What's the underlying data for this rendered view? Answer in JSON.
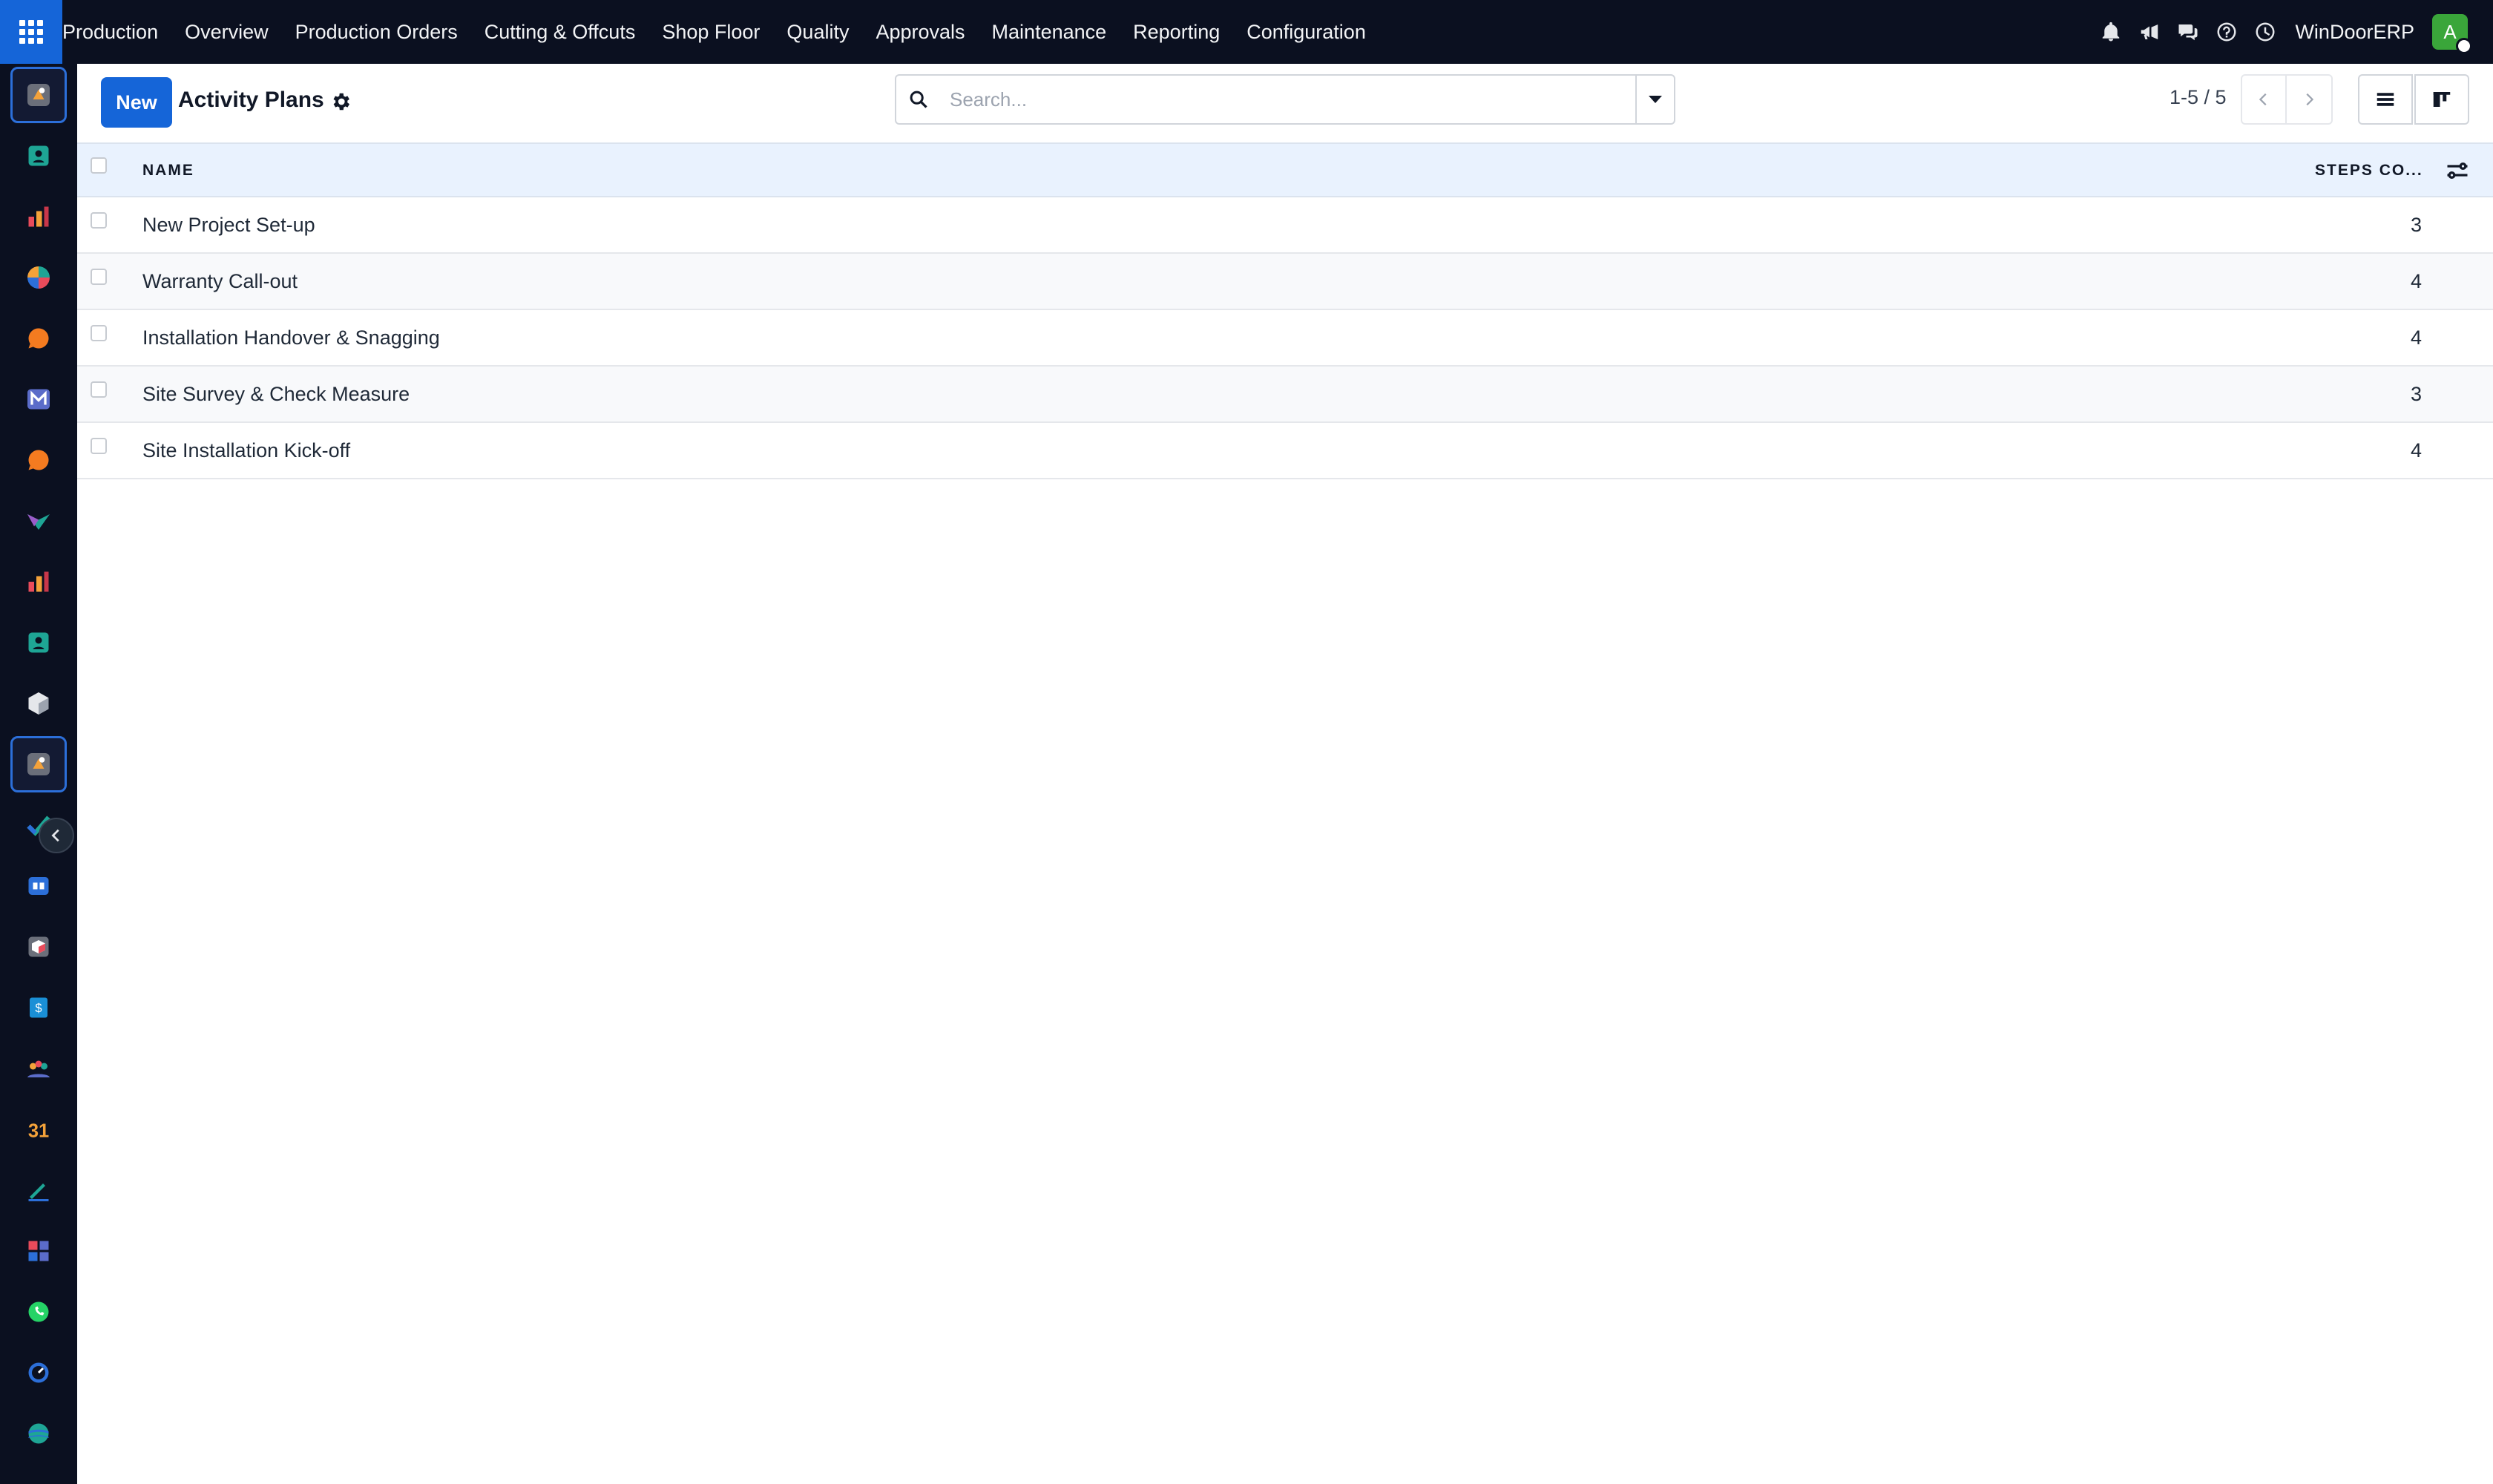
{
  "topbar": {
    "menu": [
      "Production",
      "Overview",
      "Production Orders",
      "Cutting & Offcuts",
      "Shop Floor",
      "Quality",
      "Approvals",
      "Maintenance",
      "Reporting",
      "Configuration"
    ],
    "company": "WinDoorERP",
    "avatar_letter": "A",
    "icons": [
      "bell-icon",
      "megaphone-icon",
      "chat-icon",
      "help-icon",
      "clock-icon"
    ]
  },
  "sidebar": {
    "apps": [
      "production-app",
      "contacts-app",
      "reporting-app",
      "dashboard-app",
      "discuss-app",
      "mail-app",
      "livechat-app",
      "website-app",
      "spreadsheet-app",
      "employees-app",
      "inventory-app",
      "production-app-active",
      "todo-app",
      "knowledge-app",
      "products-app",
      "invoicing-app",
      "team-app",
      "calendar-app",
      "sign-app",
      "documents-app",
      "whatsapp-app",
      "timer-app",
      "helpdesk-app"
    ]
  },
  "control": {
    "new_label": "New",
    "title": "Activity Plans",
    "search_placeholder": "Search...",
    "pager": "1-5 / 5"
  },
  "table": {
    "columns": {
      "name": "NAME",
      "steps": "STEPS CO..."
    },
    "rows": [
      {
        "name": "New Project Set-up",
        "steps": "3"
      },
      {
        "name": "Warranty Call-out",
        "steps": "4"
      },
      {
        "name": "Installation Handover & Snagging",
        "steps": "4"
      },
      {
        "name": "Site Survey & Check Measure",
        "steps": "3"
      },
      {
        "name": "Site Installation Kick-off",
        "steps": "4"
      }
    ]
  },
  "colors": {
    "accent": "#1565d8",
    "nav_bg": "#0b1020",
    "header_bg": "#e9f2fe",
    "avatar": "#3aa63a"
  }
}
